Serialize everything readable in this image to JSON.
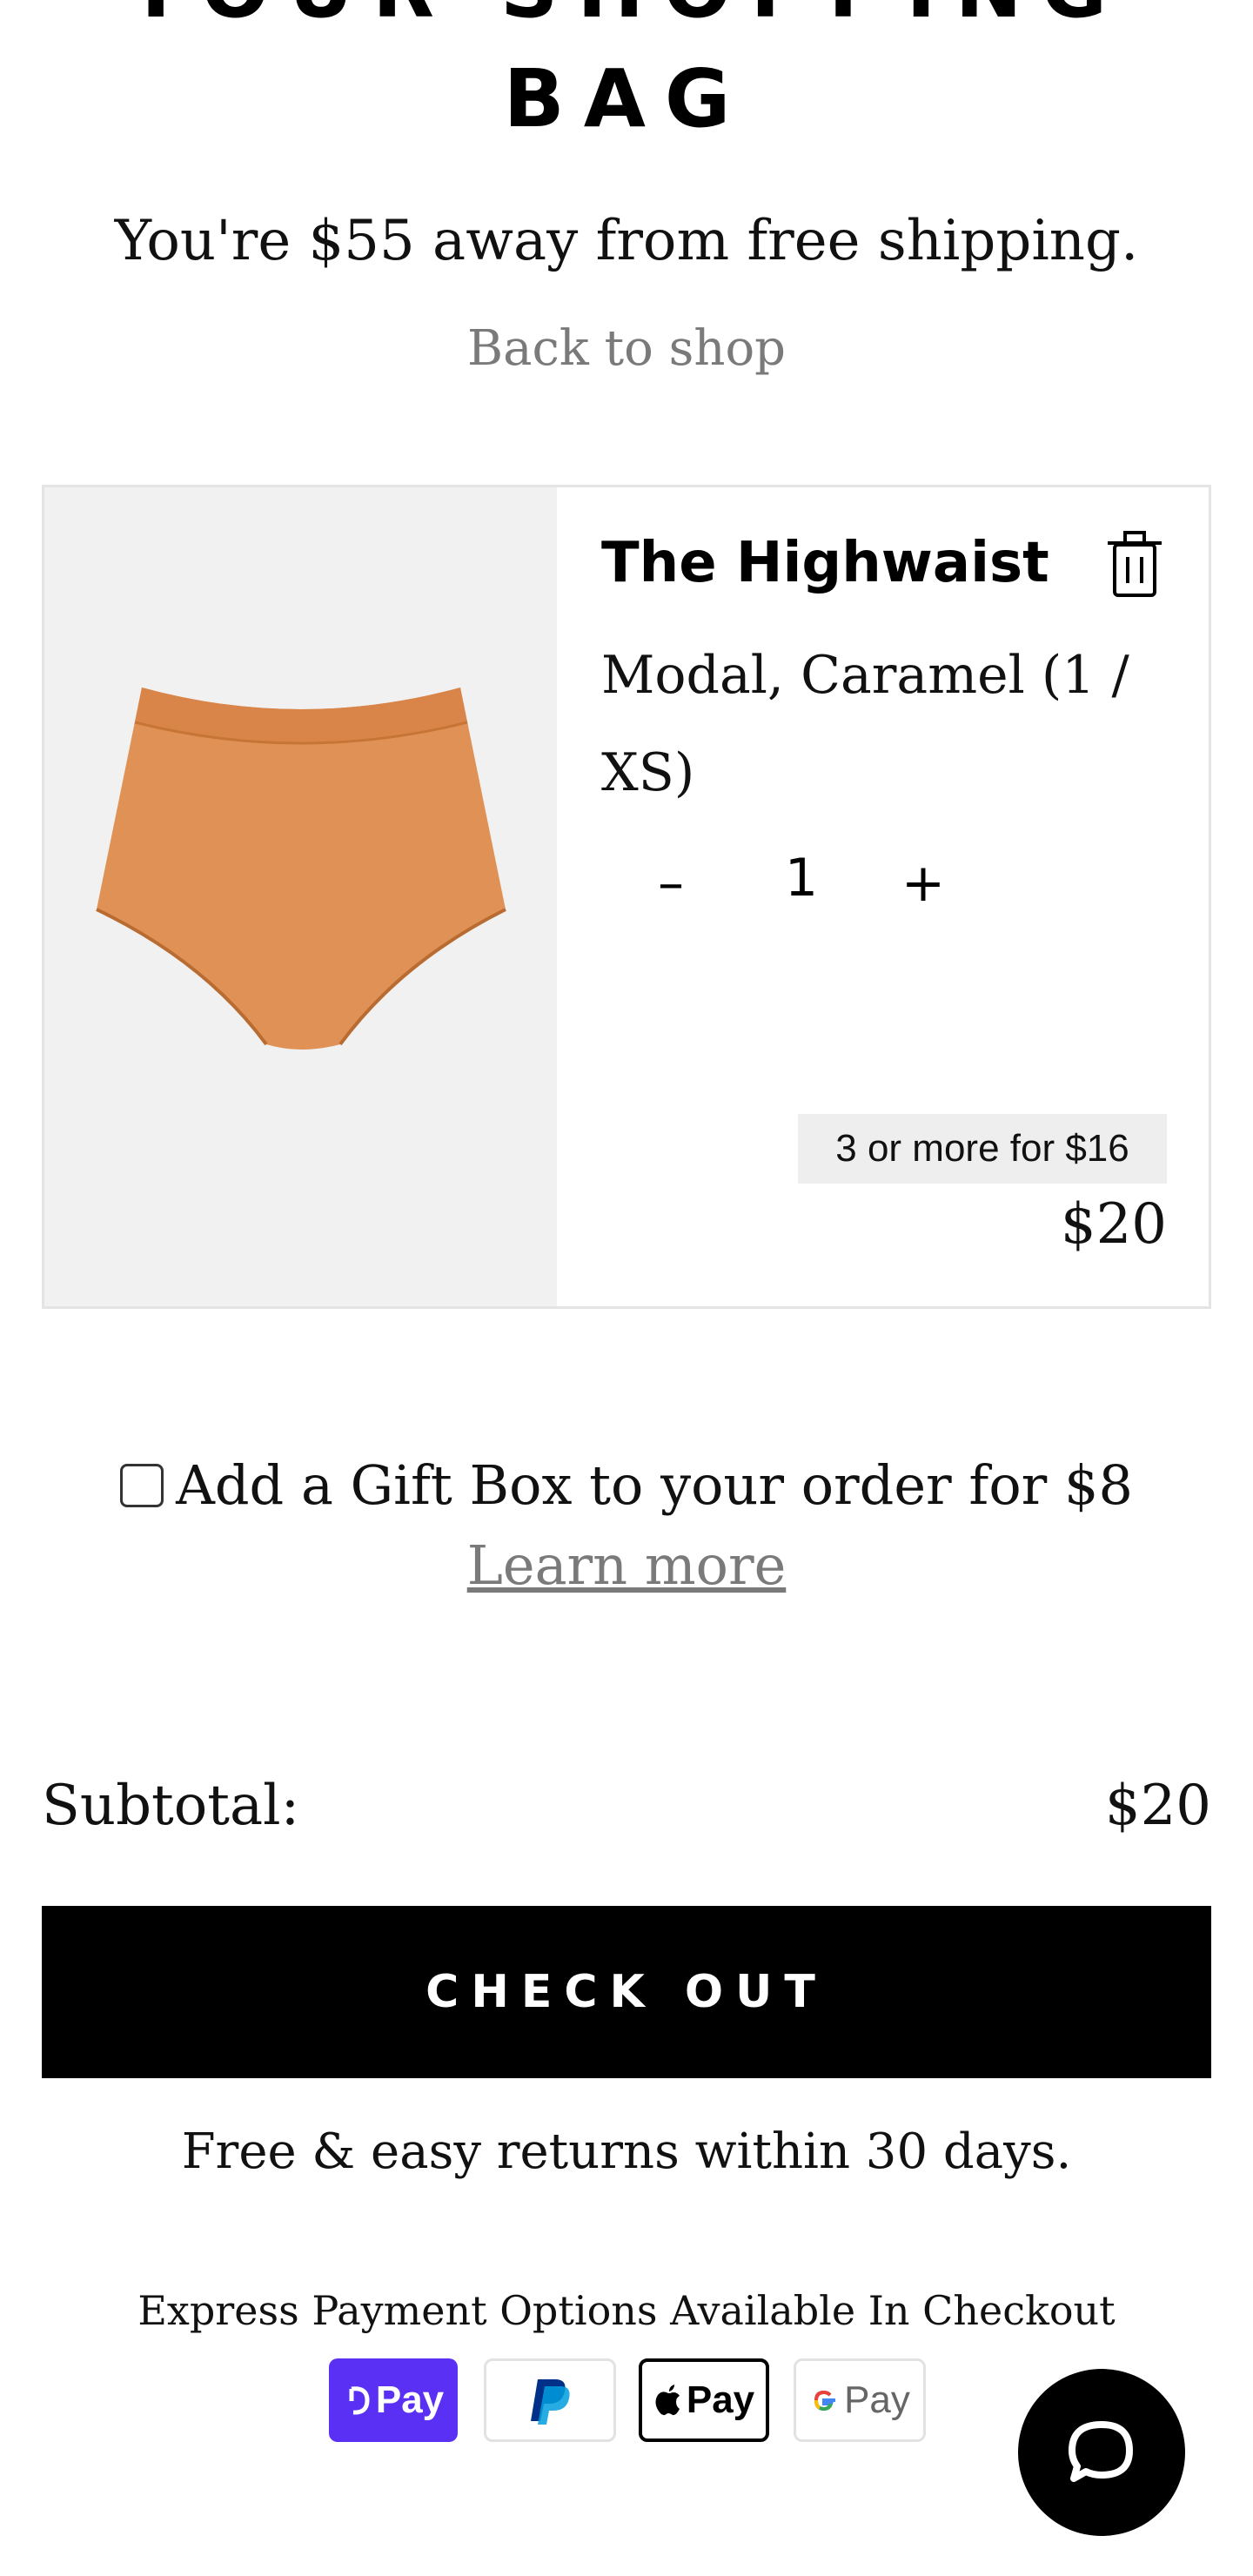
{
  "header": {
    "title_line1": "YOUR SHOPPING",
    "title_line2": "BAG"
  },
  "shipping_message": "You're $55 away from free shipping.",
  "back_to_shop": "Back to shop",
  "cart_item": {
    "name": "The Highwaist",
    "variant": "Modal, Caramel (1 / XS)",
    "quantity": "1",
    "minus_label": "–",
    "plus_label": "+",
    "promo": "3 or more for $16",
    "price": "$20",
    "product_color": "#e09155"
  },
  "gift": {
    "label": "Add a Gift Box to your order for $8",
    "learn_more": "Learn more"
  },
  "subtotal": {
    "label": "Subtotal:",
    "value": "$20"
  },
  "checkout_label": "CHECK OUT",
  "returns_text": "Free & easy returns within 30 days.",
  "express": {
    "heading": "Express Payment Options Available In Checkout",
    "shop_pay": "Pay",
    "apple_pay": "Pay",
    "google_pay": "Pay"
  },
  "colors": {
    "shop_pay": "#5a31f4",
    "paypal_dark": "#003087",
    "paypal_light": "#009cde"
  }
}
